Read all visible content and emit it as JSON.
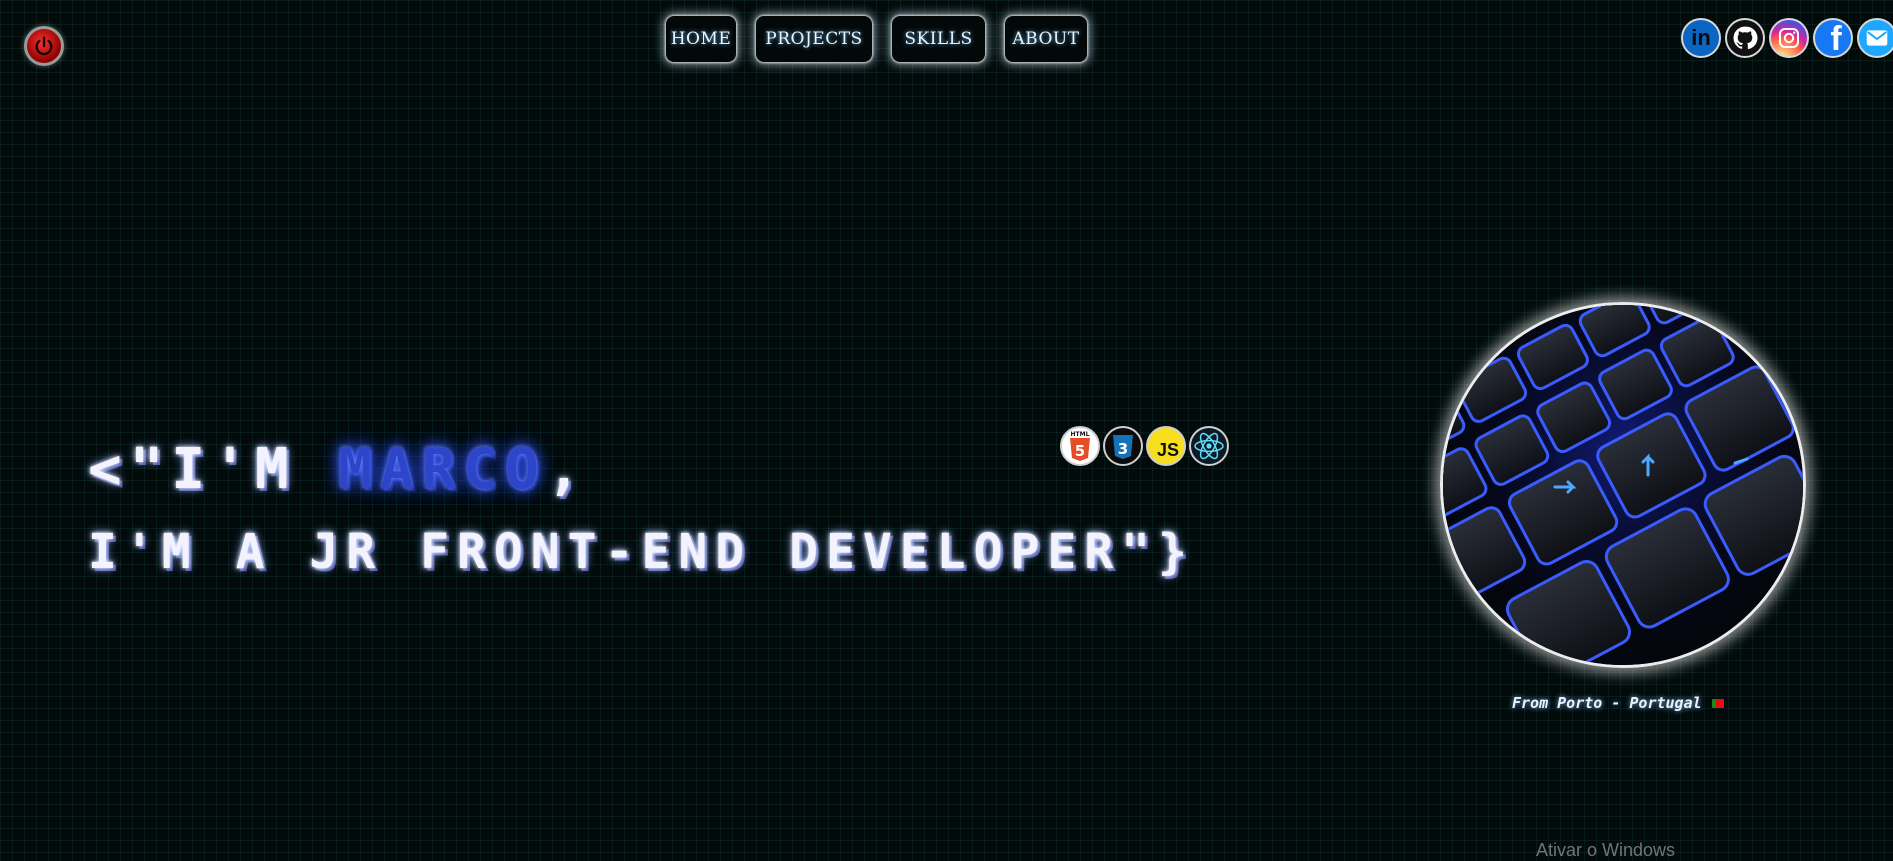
{
  "power": {
    "icon": "power-icon"
  },
  "nav": {
    "items": [
      {
        "label": "HOME"
      },
      {
        "label": "PROJECTS"
      },
      {
        "label": "SKILLS"
      },
      {
        "label": "ABOUT"
      }
    ]
  },
  "socials": [
    {
      "icon": "linkedin-icon",
      "label": "in",
      "color": "#0a66c2"
    },
    {
      "icon": "github-icon",
      "color": "#111111"
    },
    {
      "icon": "instagram-icon",
      "color": "#d6249f"
    },
    {
      "icon": "facebook-icon",
      "label": "f",
      "color": "#1877f2"
    },
    {
      "icon": "mail-icon",
      "color": "#1ea7ff"
    }
  ],
  "hero": {
    "line1_prefix": "<\"I'M ",
    "name": "MARCO",
    "line1_suffix": ",",
    "line2": "I'M A JR FRONT-END DEVELOPER\"}"
  },
  "tech": [
    {
      "icon": "html5-icon",
      "label": "5",
      "caption": "HTML",
      "color": "#e44d26"
    },
    {
      "icon": "css3-icon",
      "label": "3",
      "color": "#1572b6"
    },
    {
      "icon": "javascript-icon",
      "label": "JS",
      "color": "#f7df1e"
    },
    {
      "icon": "react-icon",
      "color": "#61dafb"
    }
  ],
  "profile": {
    "location": "From Porto - Portugal"
  },
  "system": {
    "watermark": "Ativar o Windows"
  }
}
